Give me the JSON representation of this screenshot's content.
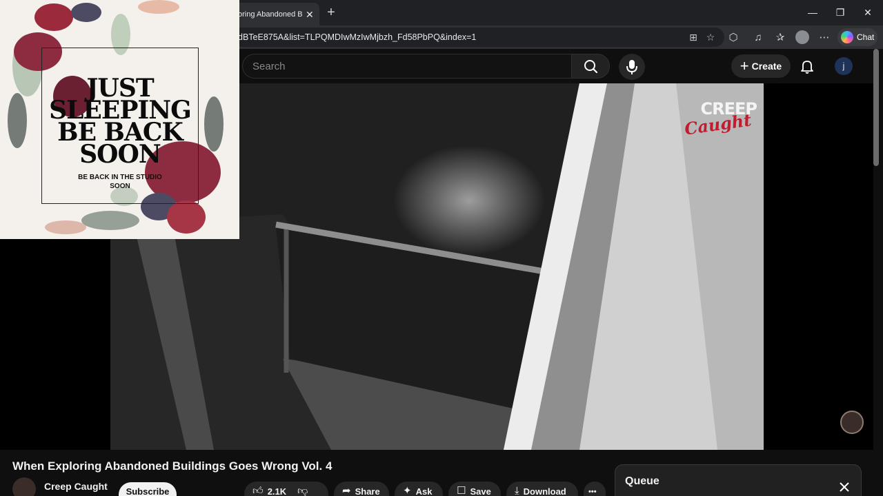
{
  "browser": {
    "tab_title": "oring Abandoned B",
    "tab_close": "✕",
    "new_tab": "+",
    "window_controls": {
      "minimize": "—",
      "maximize": "❐",
      "close": "✕"
    },
    "address_url": "dBTeE875A&list=TLPQMDIwMzIwMjbzh_Fd58PbPQ&index=1",
    "chat_label": "Chat",
    "more_icon": "⋯"
  },
  "youtube": {
    "search_placeholder": "Search",
    "create_label": "Create",
    "user_initial": "j"
  },
  "video": {
    "watermark_top": "CREEP",
    "watermark_bottom": "Caught",
    "title": "When Exploring Abandoned Buildings Goes Wrong Vol. 4"
  },
  "overlay_card": {
    "title_lines": [
      "JUST",
      "SLEEPING",
      "BE BACK",
      "SOON"
    ],
    "subtitle_lines": [
      "BE BACK IN THE STUDIO",
      "SOON"
    ]
  },
  "channel": {
    "name": "Creep Caught",
    "subscribe_label": "Subscribe"
  },
  "actions": {
    "likes": "2.1K",
    "share": "Share",
    "ask": "Ask",
    "save": "Save",
    "download": "Download",
    "more": "•••"
  },
  "queue": {
    "title": "Queue"
  },
  "colors": {
    "page_bg": "#0f0f0f",
    "browser_chrome": "#2f3033",
    "watermark_red": "#c01b2e",
    "overlay_bg": "#f4f1ed"
  }
}
